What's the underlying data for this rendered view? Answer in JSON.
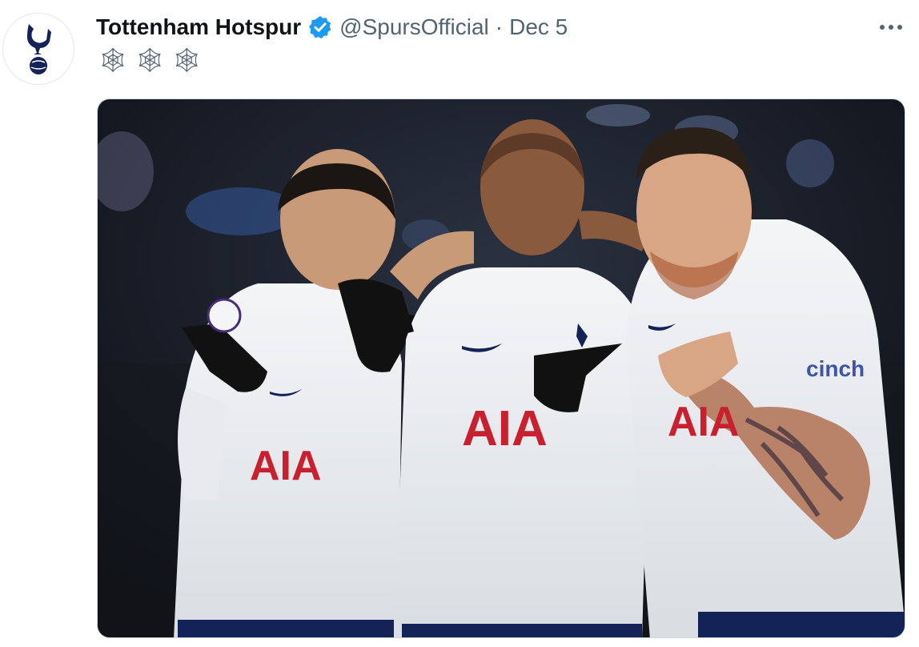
{
  "tweet": {
    "display_name": "Tottenham Hotspur",
    "handle": "@SpursOfficial",
    "separator": "·",
    "timestamp": "Dec 5",
    "verified": true,
    "more_icon": "more-horizontal-icon",
    "text": [
      "🕸",
      "🕸",
      "🕸"
    ],
    "media": {
      "type": "photo",
      "sponsor_text": "AIA",
      "sleeve_text": "cinch"
    }
  },
  "colors": {
    "verified": "#1d9bf0",
    "name": "#0f1419",
    "meta": "#536471",
    "spurs_navy": "#132257",
    "kit_white": "#eef0f2",
    "sponsor_red": "#c8202e"
  }
}
